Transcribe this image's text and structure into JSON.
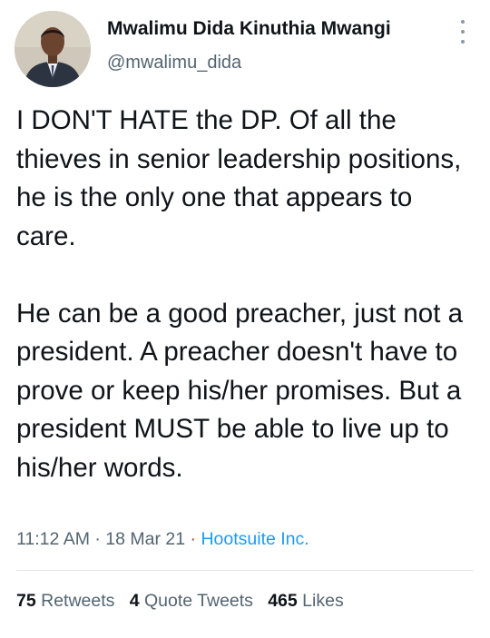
{
  "user": {
    "display_name": "Mwalimu Dida Kinuthia Mwangi",
    "handle": "@mwalimu_dida"
  },
  "tweet": {
    "paragraph_1": "I DON'T HATE the DP. Of all the thieves in senior leadership positions, he is the only one that appears to care.",
    "paragraph_2": "He can be a good preacher, just not a president. A preacher doesn't have to prove or keep his/her promises. But a president MUST be able to live up to his/her words."
  },
  "meta": {
    "time": "11:12 AM",
    "separator": " · ",
    "date": "18 Mar 21",
    "source": "Hootsuite Inc."
  },
  "stats": {
    "retweets_count": "75",
    "retweets_label": "Retweets",
    "quote_tweets_count": "4",
    "quote_tweets_label": "Quote Tweets",
    "likes_count": "465",
    "likes_label": "Likes"
  },
  "icons": {
    "more": "more-vertical-icon"
  },
  "colors": {
    "text_primary": "#0f1419",
    "text_secondary": "#536471",
    "link": "#1d9bf0"
  }
}
